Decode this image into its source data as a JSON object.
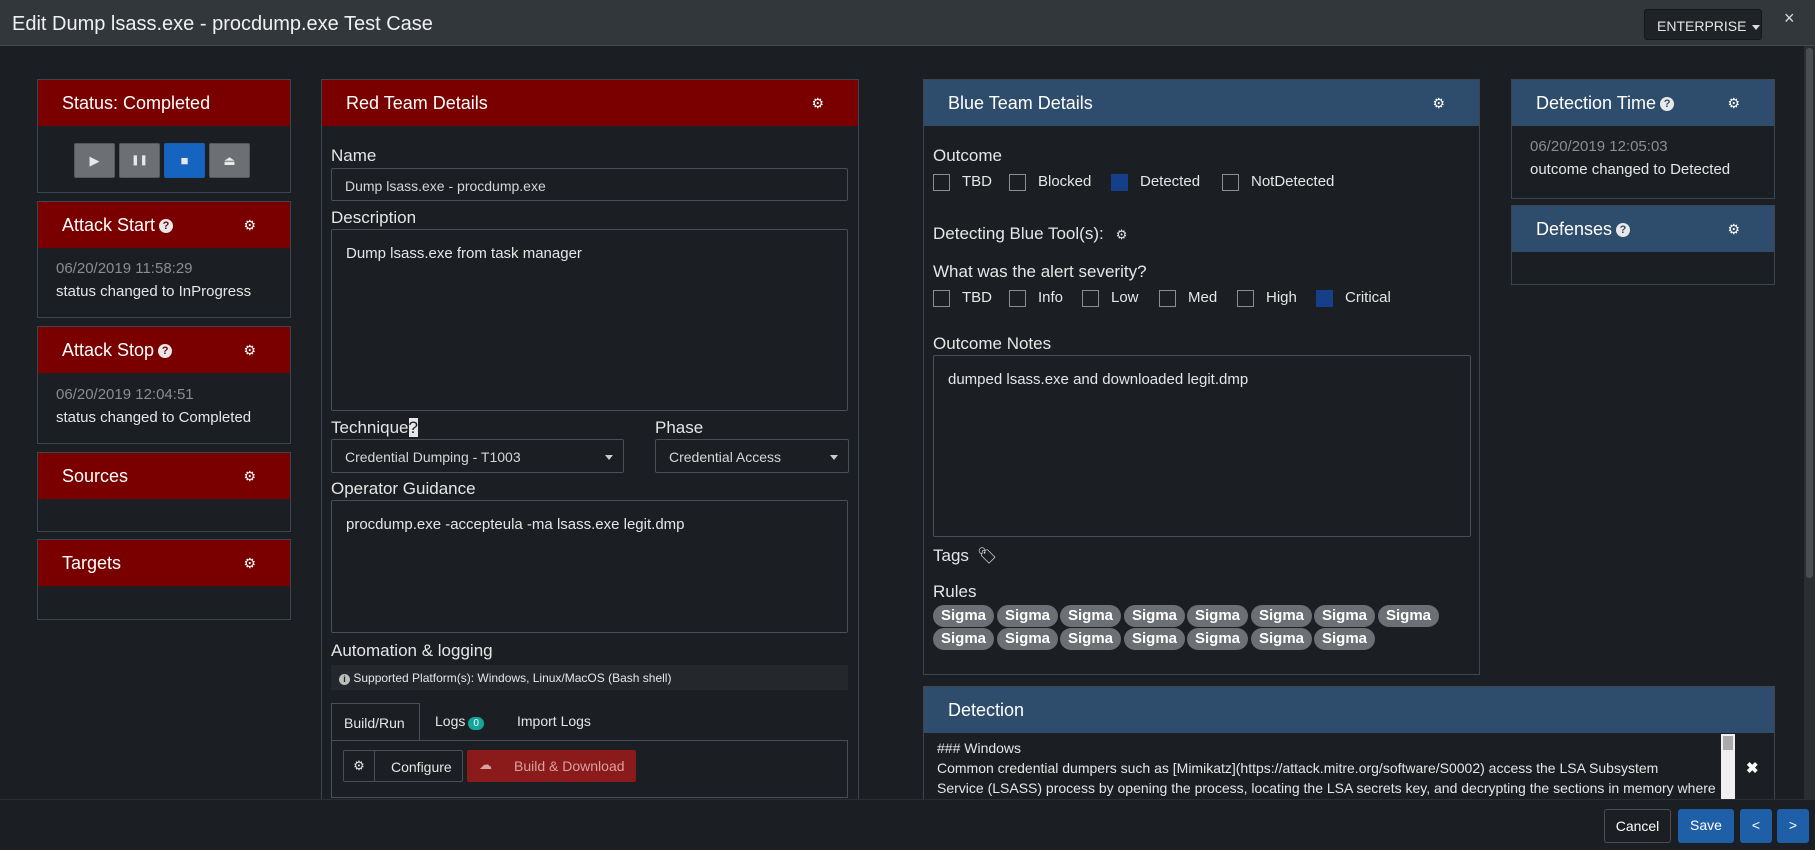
{
  "modal": {
    "title": "Edit Dump lsass.exe - procdump.exe Test Case",
    "edition_label": "ENTERPRISE",
    "close_glyph": "×"
  },
  "status_panel": {
    "title": "Status: Completed",
    "controls": [
      {
        "icon": "play-icon",
        "glyph": "▶",
        "active": false
      },
      {
        "icon": "pause-icon",
        "glyph": "❚❚",
        "active": false
      },
      {
        "icon": "stop-icon",
        "glyph": "■",
        "active": true
      },
      {
        "icon": "eject-icon",
        "glyph": "⏏",
        "active": false
      }
    ]
  },
  "attack_start": {
    "title": "Attack Start",
    "timestamp": "06/20/2019 11:58:29",
    "message": "status changed to InProgress"
  },
  "attack_stop": {
    "title": "Attack Stop",
    "timestamp": "06/20/2019 12:04:51",
    "message": "status changed to Completed"
  },
  "sources": {
    "title": "Sources"
  },
  "targets": {
    "title": "Targets"
  },
  "red_team": {
    "title": "Red Team Details",
    "name_label": "Name",
    "name_value": "Dump lsass.exe - procdump.exe",
    "description_label": "Description",
    "description_value": "Dump lsass.exe from task manager",
    "technique_label": "Technique",
    "technique_value": "Credential Dumping - T1003",
    "phase_label": "Phase",
    "phase_value": "Credential Access",
    "guidance_label": "Operator Guidance",
    "guidance_value": "procdump.exe -accepteula -ma lsass.exe legit.dmp",
    "automation_label": "Automation & logging",
    "platforms_text": "Supported Platform(s): Windows, Linux/MacOS (Bash shell)",
    "tabs": {
      "build": "Build/Run",
      "logs": "Logs",
      "logs_count": "0",
      "import": "Import Logs"
    },
    "configure_label": "Configure",
    "build_label": "Build & Download"
  },
  "blue_team": {
    "title": "Blue Team Details",
    "outcome_label": "Outcome",
    "outcomes": [
      {
        "label": "TBD",
        "checked": false
      },
      {
        "label": "Blocked",
        "checked": false
      },
      {
        "label": "Detected",
        "checked": true
      },
      {
        "label": "NotDetected",
        "checked": false
      }
    ],
    "tools_label": "Detecting Blue Tool(s):",
    "severity_label": "What was the alert severity?",
    "severities": [
      {
        "label": "TBD",
        "checked": false
      },
      {
        "label": "Info",
        "checked": false
      },
      {
        "label": "Low",
        "checked": false
      },
      {
        "label": "Med",
        "checked": false
      },
      {
        "label": "High",
        "checked": false
      },
      {
        "label": "Critical",
        "checked": true
      }
    ],
    "notes_label": "Outcome Notes",
    "notes_value": "dumped lsass.exe and downloaded legit.dmp",
    "tags_label": "Tags",
    "rules_label": "Rules",
    "rules": [
      "Sigma",
      "Sigma",
      "Sigma",
      "Sigma",
      "Sigma",
      "Sigma",
      "Sigma",
      "Sigma",
      "Sigma",
      "Sigma",
      "Sigma",
      "Sigma",
      "Sigma",
      "Sigma",
      "Sigma"
    ]
  },
  "detection_time": {
    "title": "Detection Time",
    "timestamp": "06/20/2019 12:05:03",
    "message": "outcome changed to Detected"
  },
  "defenses": {
    "title": "Defenses"
  },
  "detection": {
    "title": "Detection",
    "line1": "### Windows",
    "line2": "Common credential dumpers such as [Mimikatz](https://attack.mitre.org/software/S0002) access the LSA Subsystem",
    "line3": "Service (LSASS) process by opening the process, locating the LSA secrets key, and decrypting the sections in memory where"
  },
  "footer": {
    "cancel": "Cancel",
    "save": "Save",
    "prev": "<",
    "next": ">"
  },
  "colors": {
    "red_header": "#7a0000",
    "blue_header": "#2e4c6b",
    "primary": "#1565c0",
    "checked": "#163f8a"
  }
}
